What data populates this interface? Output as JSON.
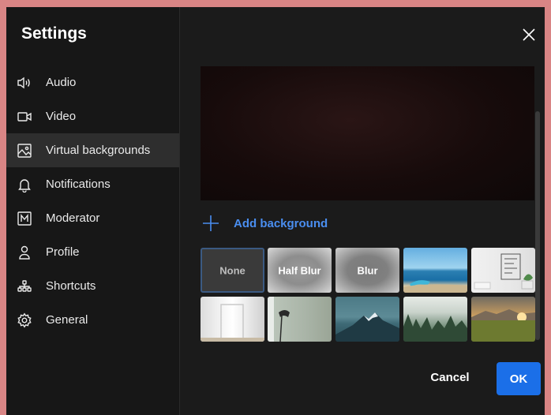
{
  "dialog": {
    "title": "Settings"
  },
  "sidebar": {
    "items": [
      {
        "label": "Audio",
        "icon": "speaker-icon",
        "active": false
      },
      {
        "label": "Video",
        "icon": "video-camera-icon",
        "active": false
      },
      {
        "label": "Virtual backgrounds",
        "icon": "image-icon",
        "active": true
      },
      {
        "label": "Notifications",
        "icon": "bell-icon",
        "active": false
      },
      {
        "label": "Moderator",
        "icon": "moderator-m-icon",
        "active": false
      },
      {
        "label": "Profile",
        "icon": "user-icon",
        "active": false
      },
      {
        "label": "Shortcuts",
        "icon": "shortcuts-icon",
        "active": false
      },
      {
        "label": "General",
        "icon": "gear-icon",
        "active": false
      }
    ]
  },
  "main": {
    "add_background_label": "Add background",
    "backgrounds": [
      {
        "label": "None",
        "selected": true
      },
      {
        "label": "Half Blur",
        "selected": false
      },
      {
        "label": "Blur",
        "selected": false
      },
      {
        "label": "",
        "image": "beach",
        "selected": false
      },
      {
        "label": "",
        "image": "room",
        "selected": false
      },
      {
        "label": "",
        "image": "white-door",
        "selected": false
      },
      {
        "label": "",
        "image": "lamp-wall",
        "selected": false
      },
      {
        "label": "",
        "image": "mountain",
        "selected": false
      },
      {
        "label": "",
        "image": "foggy-forest",
        "selected": false
      },
      {
        "label": "",
        "image": "sunset-field",
        "selected": false
      }
    ]
  },
  "footer": {
    "cancel_label": "Cancel",
    "ok_label": "OK"
  },
  "colors": {
    "accent": "#1b6fe8",
    "link": "#4a8ef0",
    "dialog_bg": "#1b1b1b",
    "backdrop": "#d98585"
  }
}
